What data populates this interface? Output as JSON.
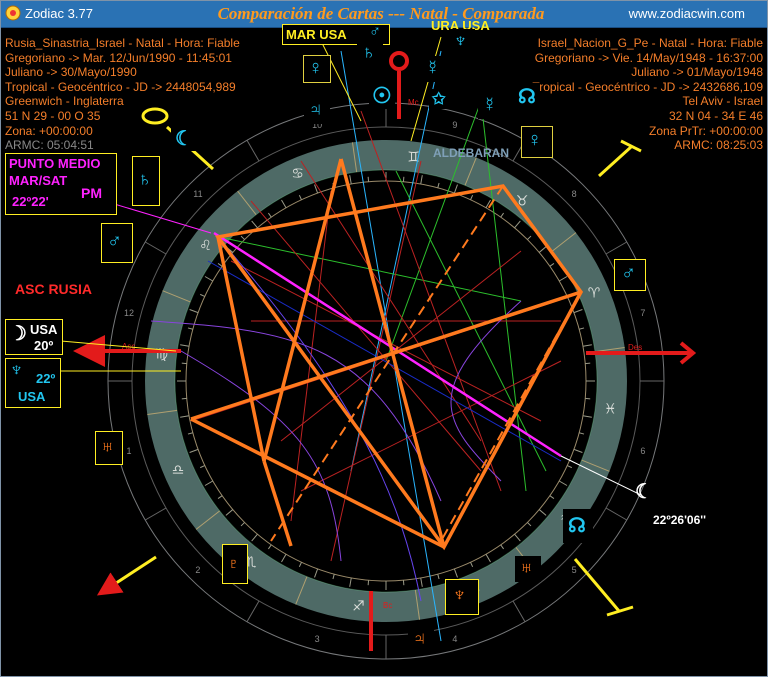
{
  "window": {
    "app_title": "Zodiac 3.77",
    "chart_title": "Comparación de Cartas --- Natal - Comparada",
    "website": "www.zodiacwin.com"
  },
  "natal": {
    "lines": [
      "Rusia_Sinastria_Israel - Natal - Hora: Fiable",
      "Gregoriano -> Mar. 12/Jun/1990 - 11:45:01",
      "Juliano -> 30/Mayo/1990",
      "Tropical - Geocéntrico - JD -> 2448054,989",
      "Greenwich - Inglaterra",
      "51 N 29 - 00 O 35",
      "Zona: +00:00:00",
      "ARMC: 05:04:51"
    ]
  },
  "compared": {
    "lines": [
      "Israel_Nacion_G_Pe - Natal - Hora: Fiable",
      "Gregoriano -> Vie. 14/May/1948 - 16:37:00",
      "Juliano -> 01/Mayo/1948",
      "Tropical - Geocéntrico - JD -> 2432686,109",
      "Tel Aviv - Israel",
      "32 N 04 - 34 E 46",
      "Zona PrTr: +00:00:00",
      "ARMC: 08:25:03"
    ]
  },
  "annotations": {
    "mar_usa": "MAR USA",
    "ura_usa": "URA USA",
    "punto_medio_1": "PUNTO MEDIO",
    "punto_medio_2": "MAR/SAT",
    "punto_medio_deg": "22º22'",
    "pm": "PM",
    "asc_rusia": "ASC RUSIA",
    "usa_moon": "USA",
    "usa_moon_deg": "20º",
    "usa_neptune_deg": "22º",
    "usa_neptune": "USA",
    "aldebaran": "ALDEBARAN",
    "moon_degree": "22º26'06''",
    "asc_label": "Asc",
    "des_label": "Des",
    "mc_label": "Mc",
    "bc_label": "Bc"
  },
  "colors": {
    "aspect_orange": "#ff7a1e",
    "midpoint_magenta": "#ff22ff",
    "annotation_yellow": "#ffee22",
    "ring": "#5a7472",
    "planet_cyan": "#22c6f0"
  },
  "glyphs": {
    "signs": [
      "♈",
      "♉",
      "♊",
      "♋",
      "♌",
      "♍",
      "♎",
      "♏",
      "♐",
      "♑",
      "♒",
      "♓"
    ],
    "house_numbers": [
      "1",
      "2",
      "3",
      "4",
      "5",
      "6",
      "7",
      "8",
      "9",
      "10",
      "11",
      "12"
    ]
  }
}
